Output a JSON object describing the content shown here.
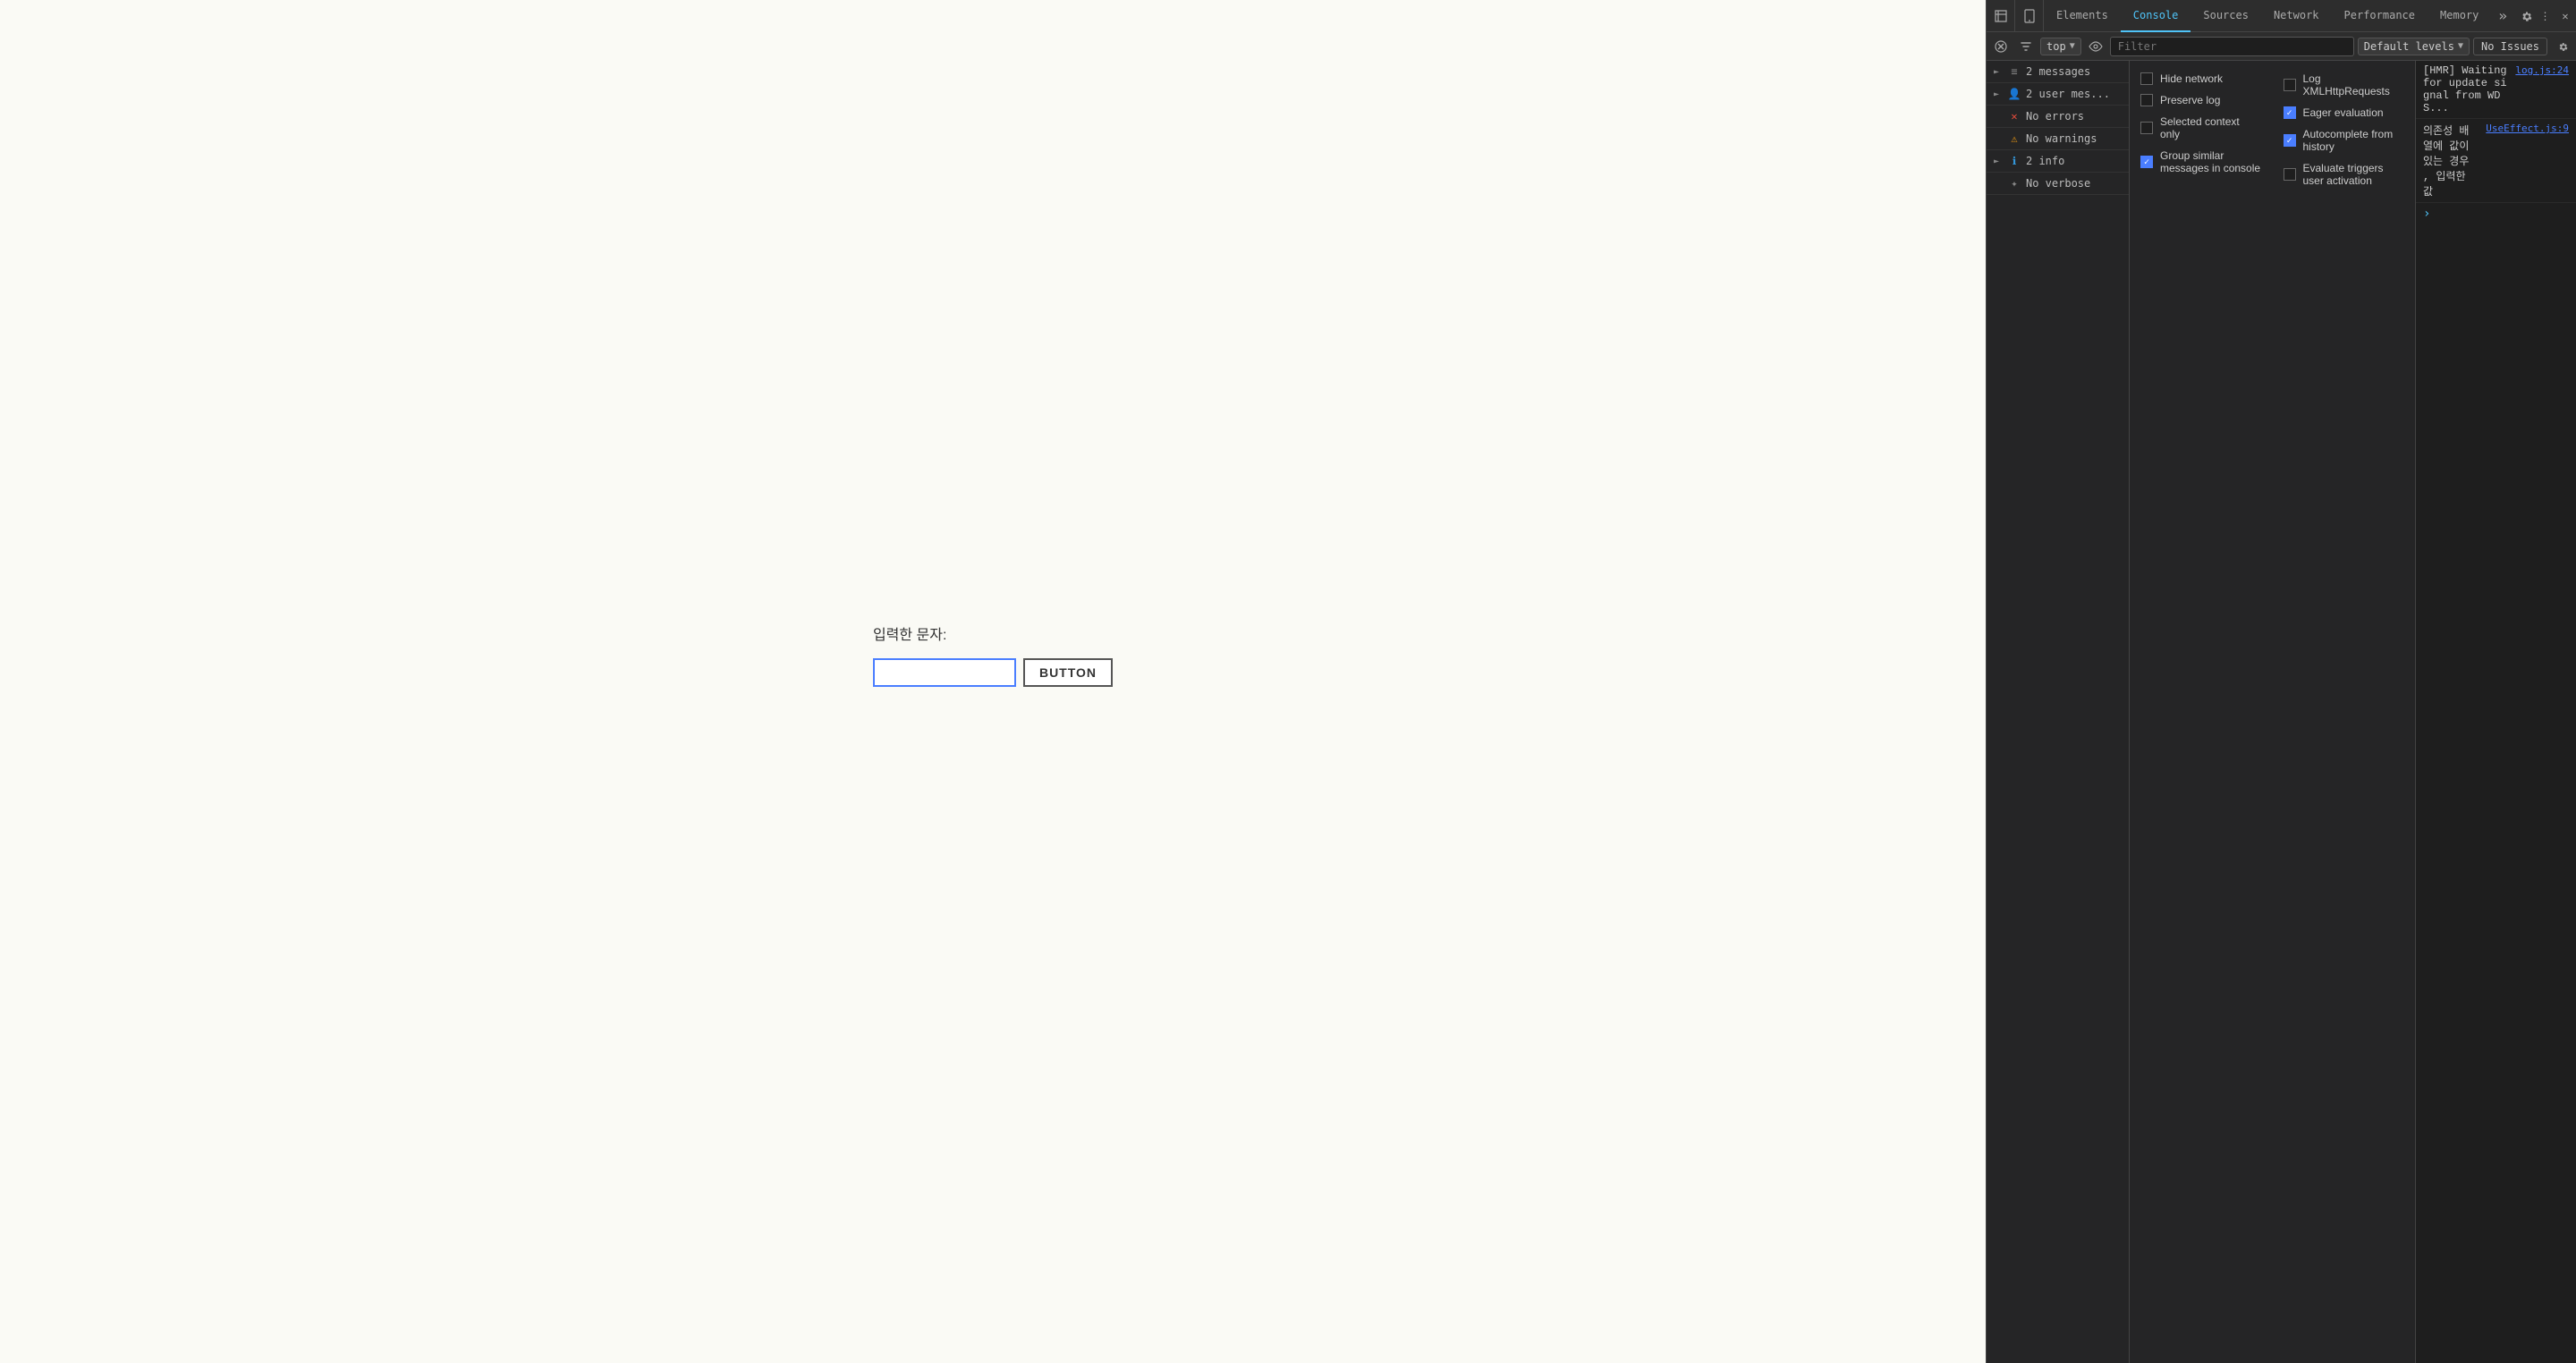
{
  "mainPage": {
    "label": "입력한 문자:",
    "inputPlaceholder": "",
    "buttonLabel": "BUTTON"
  },
  "devtools": {
    "tabs": [
      {
        "id": "elements",
        "label": "Elements",
        "active": false
      },
      {
        "id": "console",
        "label": "Console",
        "active": true
      },
      {
        "id": "sources",
        "label": "Sources",
        "active": false
      },
      {
        "id": "network",
        "label": "Network",
        "active": false
      },
      {
        "id": "performance",
        "label": "Performance",
        "active": false
      },
      {
        "id": "memory",
        "label": "Memory",
        "active": false
      }
    ],
    "toolbar": {
      "contextLabel": "top",
      "filterPlaceholder": "Filter",
      "levelLabel": "Default levels",
      "noIssuesLabel": "No Issues"
    },
    "sidebar": {
      "items": [
        {
          "id": "messages",
          "icon": "≡",
          "iconClass": "icon-messages",
          "label": "2 messages",
          "hasArrow": true,
          "expandArrow": "►"
        },
        {
          "id": "user-messages",
          "icon": "👤",
          "iconClass": "icon-user",
          "label": "2 user mes...",
          "hasArrow": true,
          "expandArrow": "►"
        },
        {
          "id": "errors",
          "icon": "✕",
          "iconClass": "icon-error",
          "label": "No errors",
          "hasArrow": false,
          "expandArrow": ""
        },
        {
          "id": "warnings",
          "icon": "⚠",
          "iconClass": "icon-warning",
          "label": "No warnings",
          "hasArrow": false,
          "expandArrow": ""
        },
        {
          "id": "info",
          "icon": "ℹ",
          "iconClass": "icon-info",
          "label": "2 info",
          "hasArrow": true,
          "expandArrow": "►"
        },
        {
          "id": "verbose",
          "icon": "✦",
          "iconClass": "icon-verbose",
          "label": "No verbose",
          "hasArrow": false,
          "expandArrow": ""
        }
      ]
    },
    "settings": {
      "leftColumn": [
        {
          "id": "hide-network",
          "label": "Hide network",
          "checked": false
        },
        {
          "id": "preserve-log",
          "label": "Preserve log",
          "checked": false
        },
        {
          "id": "selected-context",
          "label": "Selected context only",
          "checked": false
        },
        {
          "id": "group-similar",
          "label": "Group similar messages in console",
          "checked": true
        }
      ],
      "rightColumn": [
        {
          "id": "log-xml",
          "label": "Log XMLHttpRequests",
          "checked": false
        },
        {
          "id": "eager-eval",
          "label": "Eager evaluation",
          "checked": true
        },
        {
          "id": "autocomplete",
          "label": "Autocomplete from history",
          "checked": true
        },
        {
          "id": "eval-triggers",
          "label": "Evaluate triggers user activation",
          "checked": false
        }
      ]
    },
    "logs": [
      {
        "id": "hmr-log",
        "icon": "",
        "text": "[HMR]  Waiting for update signal from WDS...",
        "source": "log.js:24"
      },
      {
        "id": "dependency-log",
        "icon": "",
        "text": "의존성 배열에 값이 있는 경우 , 입력한 값",
        "source": "UseEffect.js:9"
      }
    ],
    "promptSymbol": ">"
  }
}
